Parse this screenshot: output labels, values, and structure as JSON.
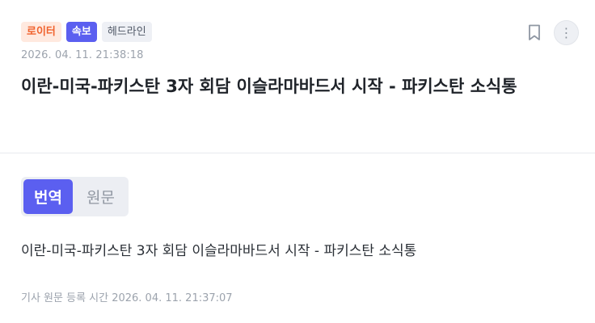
{
  "tags": {
    "source": "로이터",
    "breaking": "속보",
    "headline": "헤드라인"
  },
  "icons": {
    "bookmark": "bookmark-icon",
    "more": "more-vertical-icon",
    "more_glyph": "⋮"
  },
  "article": {
    "timestamp": "2026. 04. 11. 21:38:18",
    "title": "이란-미국-파키스탄 3자 회담 이슬라마바드서 시작 - 파키스탄 소식통",
    "body": "이란-미국-파키스탄 3자 회담 이슬라마바드서 시작 - 파키스탄 소식통",
    "original_registered": "기사 원문 등록 시간 2026. 04. 11. 21:37:07"
  },
  "toggle": {
    "translated": "번역",
    "original": "원문",
    "selected": "번역"
  },
  "colors": {
    "accent": "#5b5ff0",
    "source_tag_bg": "#ffe9df",
    "source_tag_text": "#f0622d",
    "muted_text": "#9ca3ad"
  }
}
